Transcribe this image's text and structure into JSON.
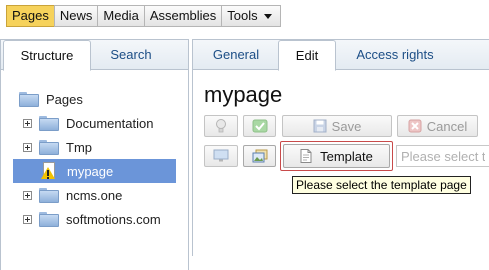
{
  "menu": {
    "items": [
      {
        "label": "Pages",
        "active": true
      },
      {
        "label": "News",
        "active": false
      },
      {
        "label": "Media",
        "active": false
      },
      {
        "label": "Assemblies",
        "active": false
      },
      {
        "label": "Tools",
        "active": false,
        "dropdown": true
      }
    ]
  },
  "left_panel": {
    "tabs": [
      {
        "label": "Structure",
        "active": true
      },
      {
        "label": "Search",
        "active": false
      }
    ],
    "tree": {
      "root": {
        "label": "Pages",
        "icon": "folder-open-icon"
      },
      "items": [
        {
          "label": "Documentation",
          "icon": "folder-icon",
          "expandable": true,
          "selected": false
        },
        {
          "label": "Tmp",
          "icon": "folder-icon",
          "expandable": true,
          "selected": false
        },
        {
          "label": "mypage",
          "icon": "warning-page-icon",
          "expandable": false,
          "selected": true
        },
        {
          "label": "ncms.one",
          "icon": "folder-icon",
          "expandable": true,
          "selected": false
        },
        {
          "label": "softmotions.com",
          "icon": "folder-icon",
          "expandable": true,
          "selected": false
        }
      ]
    }
  },
  "right_panel": {
    "tabs": [
      {
        "label": "General",
        "active": false
      },
      {
        "label": "Edit",
        "active": true
      },
      {
        "label": "Access rights",
        "active": false
      }
    ],
    "page_title": "mypage",
    "toolbar": {
      "save_label": "Save",
      "cancel_label": "Cancel",
      "template_label": "Template",
      "template_select_placeholder": "Please select th"
    },
    "tooltip": "Please select the template page"
  },
  "colors": {
    "active_menu": "#f6d25b",
    "selected_row": "#6b95d9",
    "tab_text": "#1c4e86",
    "focus_border": "#c84a4a",
    "tooltip_bg": "#ffffe1"
  }
}
